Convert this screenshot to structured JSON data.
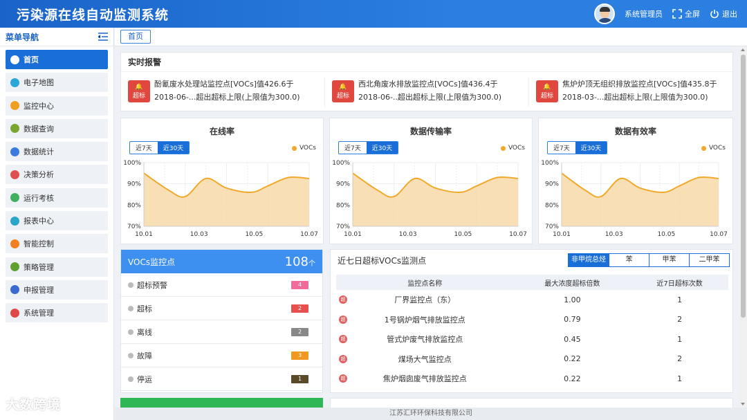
{
  "header": {
    "title": "污染源在线自动监测系统",
    "user": "系统管理员",
    "fullscreen": "全屏",
    "logout": "退出"
  },
  "sidebar": {
    "title": "菜单导航",
    "items": [
      {
        "label": "首页",
        "icon": "home-icon",
        "color": "#1a6ed8"
      },
      {
        "label": "电子地图",
        "icon": "map-icon",
        "color": "#2aa6d8"
      },
      {
        "label": "监控中心",
        "icon": "monitor-icon",
        "color": "#f0a020"
      },
      {
        "label": "数据查询",
        "icon": "data-query-icon",
        "color": "#7aa630"
      },
      {
        "label": "数据统计",
        "icon": "statistics-icon",
        "color": "#3a7ae0"
      },
      {
        "label": "决策分析",
        "icon": "decision-icon",
        "color": "#e05050"
      },
      {
        "label": "运行考核",
        "icon": "assessment-icon",
        "color": "#40b060"
      },
      {
        "label": "报表中心",
        "icon": "report-icon",
        "color": "#2aa6c8"
      },
      {
        "label": "智能控制",
        "icon": "control-icon",
        "color": "#f08020"
      },
      {
        "label": "策略管理",
        "icon": "strategy-icon",
        "color": "#60a030"
      },
      {
        "label": "申报管理",
        "icon": "declare-icon",
        "color": "#3a6ad0"
      },
      {
        "label": "系统管理",
        "icon": "system-icon",
        "color": "#e04848"
      }
    ]
  },
  "breadcrumb": {
    "home": "首页"
  },
  "alarm": {
    "title": "实时报警",
    "badge": "超标",
    "items": [
      {
        "line1": "酚氰废水处理站监控点[VOCs]值426.6于",
        "line2": "2018-06-...超出超标上限(上限值为300.0)"
      },
      {
        "line1": "西北角废水排放监控点[VOCs]值436.4于",
        "line2": "2018-06-..超出超标上限(上限值为300.0)"
      },
      {
        "line1": "焦炉炉顶无组织排放监控点[VOCs]值435.8于",
        "line2": "2018-03-...超出超标上限(上限值为300.0)"
      }
    ]
  },
  "toggle": {
    "week": "近7天",
    "month": "近30天"
  },
  "chart_data": [
    {
      "type": "area",
      "title": "在线率",
      "x": [
        "10.01",
        "10.03",
        "10.05",
        "10.07"
      ],
      "ylim": [
        70,
        100
      ],
      "yticks": [
        "100%",
        "90%",
        "80%",
        "70%"
      ],
      "series": [
        {
          "name": "VOCs",
          "points": [
            [
              0,
              95
            ],
            [
              0.6,
              87
            ],
            [
              1,
              84
            ],
            [
              1.5,
              92.5
            ],
            [
              2,
              88
            ],
            [
              2.6,
              86
            ],
            [
              3,
              89
            ],
            [
              3.5,
              93
            ],
            [
              4,
              92.5
            ]
          ]
        }
      ],
      "color": "#f0a92a"
    },
    {
      "type": "area",
      "title": "数据传输率",
      "x": [
        "10.01",
        "10.03",
        "10.05",
        "10.07"
      ],
      "ylim": [
        70,
        100
      ],
      "yticks": [
        "100%",
        "90%",
        "80%",
        "70%"
      ],
      "series": [
        {
          "name": "VOCs",
          "points": [
            [
              0,
              95
            ],
            [
              0.6,
              87
            ],
            [
              1,
              84
            ],
            [
              1.5,
              92.5
            ],
            [
              2,
              88
            ],
            [
              2.6,
              86
            ],
            [
              3,
              89
            ],
            [
              3.5,
              93
            ],
            [
              4,
              92.5
            ]
          ]
        }
      ],
      "color": "#f0a92a"
    },
    {
      "type": "area",
      "title": "数据有效率",
      "x": [
        "10.01",
        "10.03",
        "10.05",
        "10.07"
      ],
      "ylim": [
        70,
        100
      ],
      "yticks": [
        "100%",
        "90%",
        "80%",
        "70%"
      ],
      "series": [
        {
          "name": "VOCs",
          "points": [
            [
              0,
              95
            ],
            [
              0.6,
              87
            ],
            [
              1,
              84
            ],
            [
              1.5,
              92.5
            ],
            [
              2,
              88
            ],
            [
              2.6,
              86
            ],
            [
              3,
              89
            ],
            [
              3.5,
              93
            ],
            [
              4,
              92.5
            ]
          ]
        }
      ],
      "color": "#f0a92a"
    }
  ],
  "vocs": {
    "title": "VOCs监控点",
    "count": "108",
    "unit": "个",
    "rows": [
      {
        "label": "超标预警",
        "value": "4",
        "color": "#f06a9a",
        "icon": "warning-light-icon"
      },
      {
        "label": "超标",
        "value": "2",
        "color": "#e85050",
        "icon": "exceed-icon"
      },
      {
        "label": "离线",
        "value": "2",
        "color": "#888888",
        "icon": "offline-icon"
      },
      {
        "label": "故障",
        "value": "3",
        "color": "#f09820",
        "icon": "fault-icon"
      },
      {
        "label": "停运",
        "value": "1",
        "color": "#5a4a2a",
        "icon": "stop-icon"
      }
    ]
  },
  "table": {
    "title": "近七日超标VOCs监测点",
    "tabs": [
      "非甲烷总烃",
      "苯",
      "甲苯",
      "二甲苯"
    ],
    "headers": [
      "监控点名称",
      "最大浓度超标倍数",
      "近7日超标次数"
    ],
    "badge": "超",
    "rows": [
      [
        "厂界监控点（东）",
        "1.00",
        "1"
      ],
      [
        "1号锅炉烟气排放监控点",
        "0.79",
        "2"
      ],
      [
        "管式炉废气排放监控点",
        "0.45",
        "1"
      ],
      [
        "煤场大气监控点",
        "0.22",
        "2"
      ],
      [
        "焦炉烟囱废气排放监控点",
        "0.22",
        "1"
      ]
    ]
  },
  "footer": "江苏汇环环保科技有限公司",
  "watermark": "大数跨境"
}
